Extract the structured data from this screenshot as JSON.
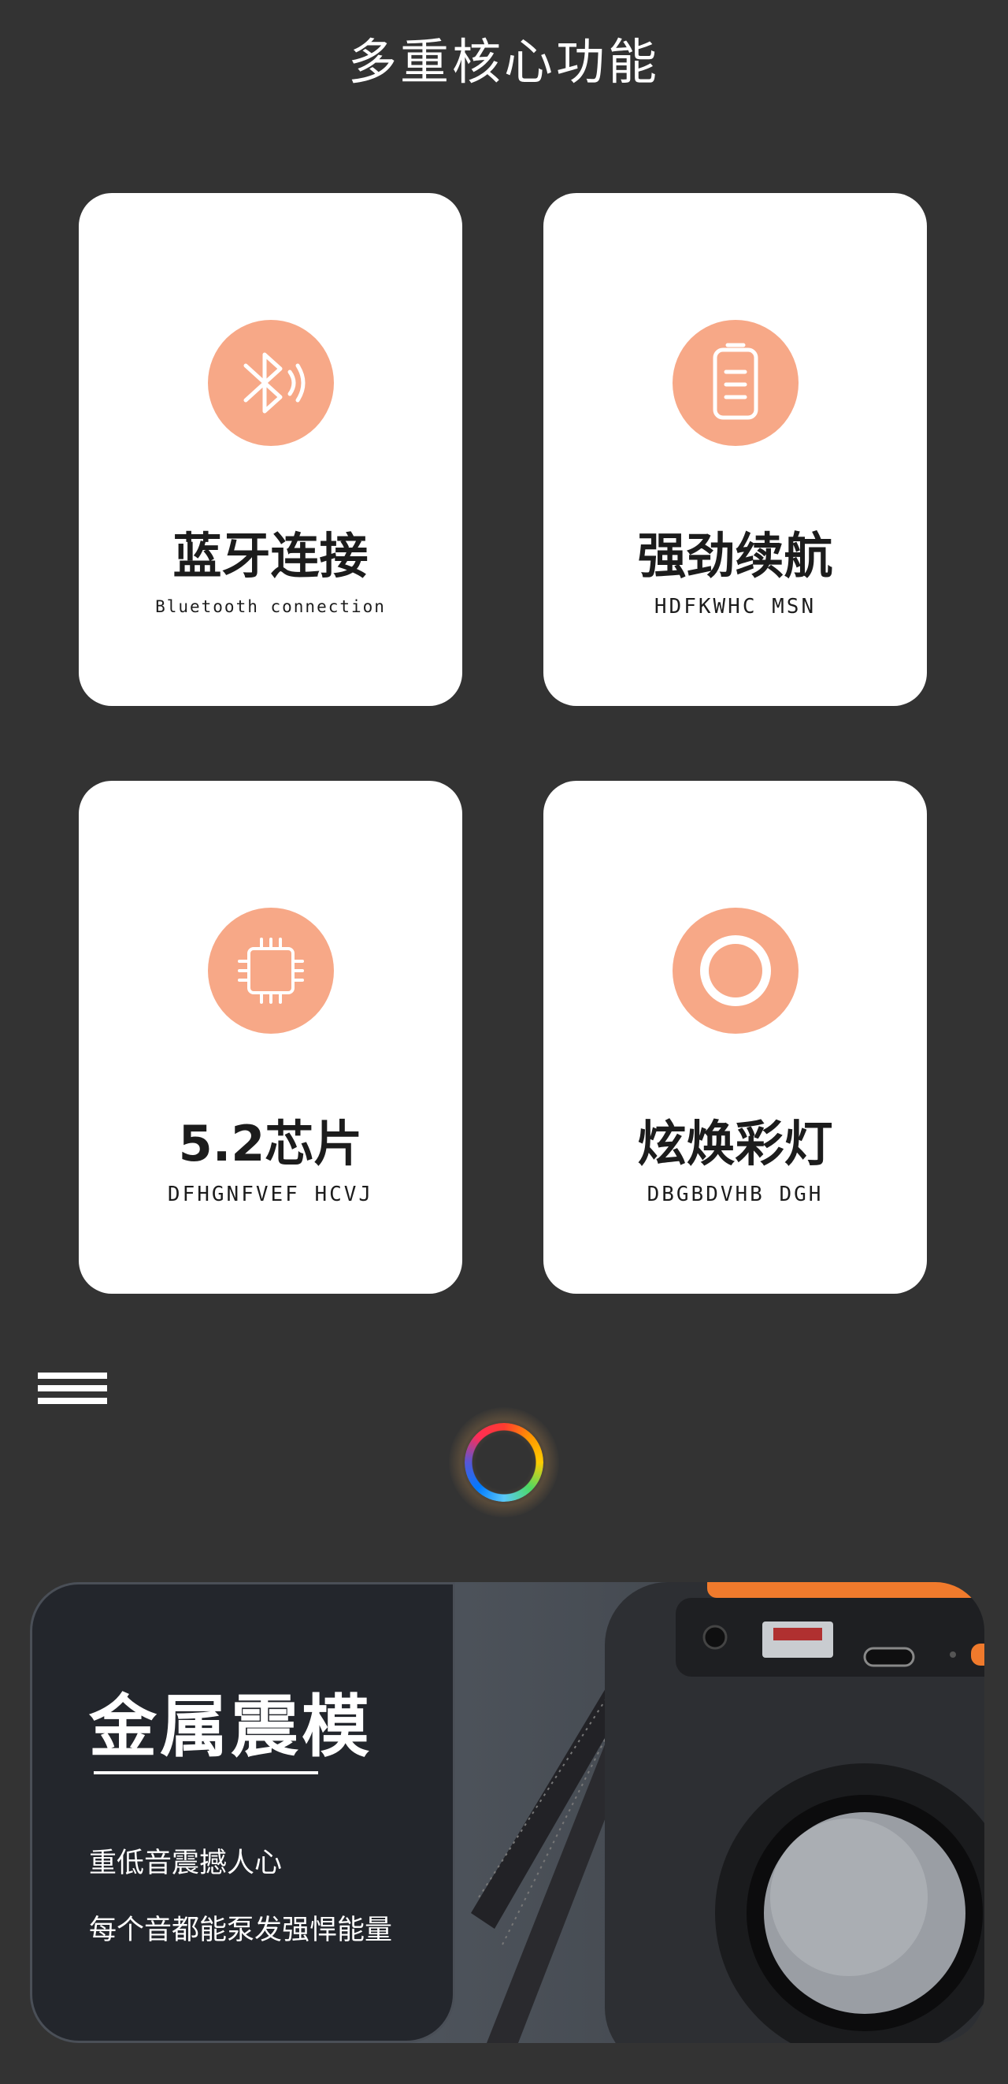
{
  "section": {
    "title": "多重核心功能"
  },
  "features": [
    {
      "title": "蓝牙连接",
      "subtitle": "Bluetooth connection",
      "icon": "bluetooth-icon"
    },
    {
      "title": "强劲续航",
      "subtitle": "HDFKWHC MSN",
      "icon": "battery-icon"
    },
    {
      "title": "5.2芯片",
      "subtitle": "DFHGNFVEF HCVJ",
      "icon": "chip-icon"
    },
    {
      "title": "炫焕彩灯",
      "subtitle": "DBGBDVHB DGH",
      "icon": "ring-light-icon"
    }
  ],
  "banner": {
    "title": "金属震模",
    "line1": "重低音震撼人心",
    "line2": "每个音都能泵发强悍能量"
  },
  "colors": {
    "background": "#333333",
    "icon_accent": "#f7a887",
    "card": "#ffffff"
  }
}
